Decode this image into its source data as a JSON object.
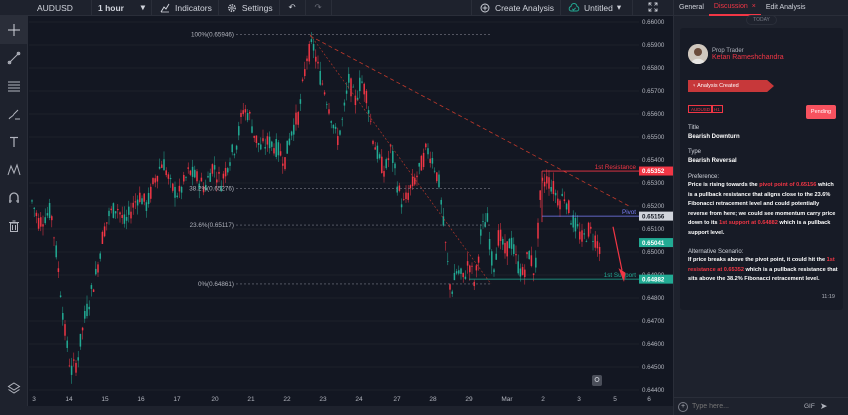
{
  "toolbar": {
    "symbol": "AUDUSD",
    "interval": "1 hour",
    "indicators_label": "Indicators",
    "settings_label": "Settings",
    "create_analysis_label": "Create Analysis",
    "layout_label": "Untitled",
    "icons": [
      "search-icon",
      "chevron-down-icon",
      "indicators-icon",
      "gear-icon",
      "undo-icon",
      "redo-icon",
      "plus-circle-icon",
      "cloud-check-icon",
      "fullscreen-icon"
    ]
  },
  "left_tools": {
    "icons": [
      "crosshair-icon",
      "trend-line-icon",
      "fib-retracement-icon",
      "brush-icon",
      "text-icon",
      "pattern-icon",
      "magnet-icon",
      "trash-icon",
      "layers-icon"
    ]
  },
  "chart": {
    "fib_levels": [
      {
        "label": "100%(0.65946)",
        "price": 0.65946
      },
      {
        "label": "38.2%(0.65276)",
        "price": 0.65276
      },
      {
        "label": "23.6%(0.65117)",
        "price": 0.65117
      },
      {
        "label": "0%(0.64861)",
        "price": 0.64861
      }
    ],
    "horizontal_lines": [
      {
        "label": "1st Resistance",
        "price": 0.65352,
        "color": "#f23645"
      },
      {
        "label": "Pivot",
        "price": 0.65156,
        "color": "#7b7ff7"
      },
      {
        "label": "1st Support",
        "price": 0.64882,
        "color": "#22ab94"
      }
    ],
    "price_ticks": [
      "0.66000",
      "0.65900",
      "0.65800",
      "0.65700",
      "0.65600",
      "0.65500",
      "0.65400",
      "0.65300",
      "0.65200",
      "0.65100",
      "0.65000",
      "0.64900",
      "0.64800",
      "0.64700",
      "0.64600",
      "0.64500",
      "0.64400"
    ],
    "price_tags": [
      {
        "text": "0.65352",
        "price": 0.65352,
        "bg": "#f23645"
      },
      {
        "text": "0.65156",
        "price": 0.65156,
        "bg": "#d1d4dc"
      },
      {
        "text": "0.65041",
        "price": 0.65041,
        "bg": "#22ab94"
      },
      {
        "text": "0.64882",
        "price": 0.64882,
        "bg": "#22ab94"
      }
    ],
    "time_ticks": [
      "3",
      "14",
      "15",
      "16",
      "17",
      "20",
      "21",
      "22",
      "23",
      "24",
      "27",
      "28",
      "29",
      "Mar",
      "2",
      "3",
      "5",
      "6"
    ],
    "colors": {
      "up": "#22ab94",
      "down": "#f23645"
    }
  },
  "panel": {
    "tabs": [
      {
        "label": "General",
        "active": false
      },
      {
        "label": "Discussion",
        "active": true
      },
      {
        "label": "Edit Analysis",
        "active": false
      }
    ],
    "today_label": "TODAY",
    "role": "Prop Trader",
    "author": "Ketan Rameshchandra",
    "status": "Analysis Created",
    "chips": [
      "AUDUSD",
      "H1"
    ],
    "pending_label": "Pending",
    "title_label": "Title",
    "title_value": "Bearish Downturn",
    "type_label": "Type",
    "type_value": "Bearish Reversal",
    "preference_label": "Preference:",
    "preference_parts": [
      "Price is rising towards the ",
      "pivot point of 0.65156",
      " which is a pullback resistance that aligns close to the 23.6% Fibonacci retracement level and could potentially reverse from here; we could see momentum carry price down to its ",
      "1st support at 0.64882",
      " which is a pullback support level."
    ],
    "alt_label": "Alternative Scenario:",
    "alt_parts": [
      "If price breaks above the pivot point, it could hit the ",
      "1st resistance at 0.65352",
      " which is a pullback resistance that sits above the 38.2% Fibonacci retracement level."
    ],
    "time": "11:19",
    "input_placeholder": "Type here...",
    "gif_label": "GIF"
  }
}
